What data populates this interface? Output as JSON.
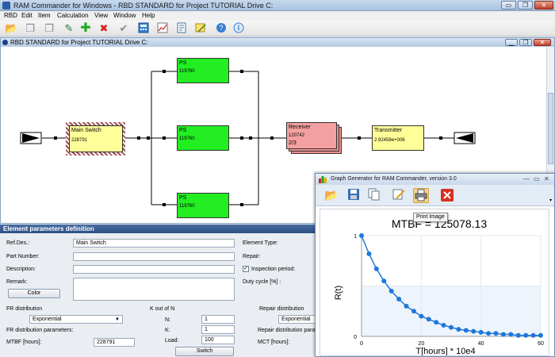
{
  "app": {
    "title": "RAM Commander for Windows - RBD STANDARD for Project TUTORIAL Drive C:",
    "window_controls": [
      "▭",
      "❐",
      "✕"
    ]
  },
  "menu": [
    "RBD",
    "Edit",
    "Item",
    "Calculation",
    "View",
    "Window",
    "Help"
  ],
  "toolbar_icons": [
    "open-folder-icon",
    "copy-icon",
    "copy-icon",
    "edit-pencil-icon",
    "add-plus-icon",
    "delete-x-icon",
    "check-icon",
    "calculator-icon",
    "chart-icon",
    "report-icon",
    "notes-icon",
    "help-icon",
    "info-icon"
  ],
  "rbd": {
    "title": "RBD STANDARD for Project TUTORIAL Drive C:",
    "blocks": {
      "ps1": {
        "name": "PS",
        "value": "119760"
      },
      "ps2": {
        "name": "PS",
        "value": "119760"
      },
      "ps3": {
        "name": "PS",
        "value": "119760"
      },
      "main_switch": {
        "name": "Main Switch",
        "value": "228791"
      },
      "receiver": {
        "name": "Receiver",
        "value": "120742",
        "k_of_n": "2/3"
      },
      "transmitter": {
        "name": "Transmitter",
        "value": "2.92458e+006"
      }
    }
  },
  "params": {
    "title": "Element parameters definition",
    "ref_des_label": "Ref.Des.:",
    "ref_des_value": "Main Switch",
    "part_number_label": "Part Number:",
    "description_label": "Description:",
    "remark_label": "Remark:",
    "color_button": "Color",
    "element_type_label": "Element Type:",
    "repair_label": "Repair:",
    "inspection_label": "Inspection period:",
    "duty_cycle_label": "Duty cycle [%] :",
    "fr_distribution_label": "FR distribution",
    "fr_distribution_value": "Exponential",
    "fr_params_label": "FR distribution parameters:",
    "mtbf_label": "MTBF [hours]:",
    "mtbf_value": "228791",
    "k_out_of_n_label": "K out of N",
    "n_label": "N:",
    "n_value": "1",
    "k_label": "K:",
    "k_value": "1",
    "load_label": "Load:",
    "load_value": "100",
    "switch_button": "Switch",
    "repair_distribution_label": "Repair distribution",
    "repair_distribution_value": "Exponential",
    "repair_params_label": "Repair distribution para",
    "mct_label": "MCT [hours]:"
  },
  "graph": {
    "window_title": "Graph Generator for RAM Commander, version 3.0",
    "tooltip": "Print Image",
    "controls": [
      "—",
      "▭",
      "✕"
    ]
  },
  "chart_data": {
    "type": "line",
    "title": "MTBF = 125078.13",
    "xlabel": "T[hours] * 10e4",
    "ylabel": "R(t)",
    "xlim": [
      0,
      60
    ],
    "ylim": [
      0,
      1
    ],
    "x_ticks": [
      "0",
      "20",
      "40",
      "60"
    ],
    "y_ticks": [
      "0",
      "0.5",
      "1"
    ],
    "grid": true,
    "series": [
      {
        "color": "#1e78dc",
        "x": [
          0,
          2.5,
          5,
          7.5,
          10,
          12.5,
          15,
          17.5,
          20,
          22.5,
          25,
          27.5,
          30,
          32.5,
          35,
          37.5,
          40,
          42.5,
          45,
          47.5,
          50,
          52.5,
          55,
          57.5,
          60
        ],
        "y": [
          1.0,
          0.82,
          0.67,
          0.55,
          0.45,
          0.37,
          0.3,
          0.25,
          0.2,
          0.17,
          0.14,
          0.11,
          0.09,
          0.07,
          0.06,
          0.05,
          0.04,
          0.03,
          0.03,
          0.02,
          0.02,
          0.01,
          0.01,
          0.01,
          0.01
        ]
      }
    ]
  }
}
